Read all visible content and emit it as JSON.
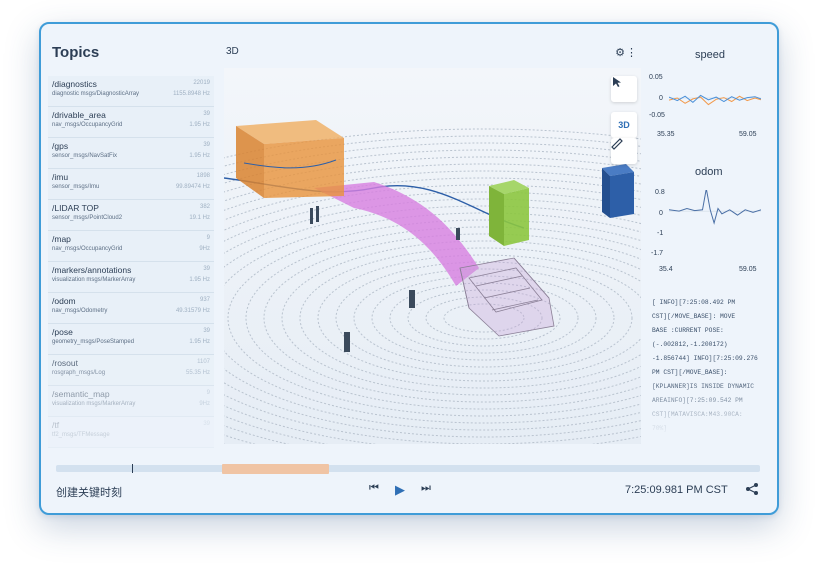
{
  "topics_panel": {
    "title": "Topics",
    "items": [
      {
        "name": "/diagnostics",
        "type": "diagnostic msgs/DiagnosticArray",
        "count": "22019",
        "rate": "1155.8948 Hz"
      },
      {
        "name": "/drivable_area",
        "type": "nav_msgs/OccupancyGrid",
        "count": "39",
        "rate": "1.95 Hz"
      },
      {
        "name": "/gps",
        "type": "sensor_msgs/NavSatFix",
        "count": "39",
        "rate": "1.95 Hz"
      },
      {
        "name": "/imu",
        "type": "sensor_msgs/Imu",
        "count": "1898",
        "rate": "99.89474 Hz"
      },
      {
        "name": "/LIDAR TOP",
        "type": "sensor_msgs/PointCloud2",
        "count": "382",
        "rate": "19.1 Hz"
      },
      {
        "name": "/map",
        "type": "nav_msgs/OccupancyGrid",
        "count": "9",
        "rate": "9Hz"
      },
      {
        "name": "/markers/annotations",
        "type": "visualization msgs/MarkerArray",
        "count": "39",
        "rate": "1.95 Hz"
      },
      {
        "name": "/odom",
        "type": "nav_msgs/Odometry",
        "count": "937",
        "rate": "49.31579 Hz"
      },
      {
        "name": "/pose",
        "type": "geometry_msgs/PoseStamped",
        "count": "39",
        "rate": "1.95 Hz"
      },
      {
        "name": "/rosout",
        "type": "rosgraph_msgs/Log",
        "count": "1107",
        "rate": "55.35 Hz"
      },
      {
        "name": "/semantic_map",
        "type": "visualization msgs/MarkerArray",
        "count": "9",
        "rate": "9Hz"
      },
      {
        "name": "/tf",
        "type": "tf2_msgs/TFMessage",
        "count": "39",
        "rate": ""
      }
    ]
  },
  "view3d": {
    "title": "3D",
    "settings_icon": "gear-icon",
    "more_icon": "kebab-icon",
    "tools": {
      "select_icon": "cursor-icon",
      "mode_label": "3D",
      "measure_icon": "ruler-icon"
    }
  },
  "charts": {
    "speed": {
      "title": "speed",
      "y_ticks": [
        "0.05",
        "0",
        "-0.05"
      ],
      "x_ticks": [
        "35.35",
        "59.05"
      ],
      "series_colors": [
        "#f2994a",
        "#4a90d9"
      ]
    },
    "odom": {
      "title": "odom",
      "y_ticks": [
        "0.8",
        "0",
        "-1",
        "-1.7"
      ],
      "x_ticks": [
        "35.4",
        "59.05"
      ],
      "series_colors": [
        "#4a6fa5"
      ]
    }
  },
  "chart_data": [
    {
      "type": "line",
      "title": "speed",
      "xlim": [
        35.35,
        59.05
      ],
      "ylim": [
        -0.05,
        0.05
      ],
      "series": [
        {
          "x": [
            35.35,
            37.5,
            39.5,
            41.5,
            43.5,
            45.5,
            47.5,
            49.5,
            51.5,
            53.5,
            55.5,
            57.5,
            59.05
          ],
          "y": [
            -0.005,
            0.0,
            -0.012,
            -0.002,
            0.002,
            -0.015,
            -0.003,
            0.001,
            -0.008,
            0.004,
            -0.006,
            0.0,
            -0.004
          ]
        },
        {
          "x": [
            35.35,
            37.5,
            39.5,
            41.5,
            43.5,
            45.5,
            47.5,
            49.5,
            51.5,
            53.5,
            55.5,
            57.5,
            59.05
          ],
          "y": [
            0.002,
            -0.006,
            0.004,
            -0.01,
            0.006,
            -0.004,
            0.002,
            -0.008,
            0.003,
            -0.005,
            0.001,
            0.003,
            -0.002
          ]
        }
      ]
    },
    {
      "type": "line",
      "title": "odom",
      "xlim": [
        35.4,
        59.05
      ],
      "ylim": [
        -1.7,
        0.8
      ],
      "series": [
        {
          "x": [
            35.4,
            38,
            40,
            42,
            44,
            45,
            46,
            47,
            48,
            49,
            51,
            53,
            55,
            57,
            59.05
          ],
          "y": [
            0.05,
            0.0,
            0.1,
            0.02,
            0.05,
            0.85,
            0.05,
            -0.45,
            0.1,
            -0.1,
            0.05,
            -0.15,
            0.05,
            -0.05,
            0.05
          ]
        }
      ]
    }
  ],
  "log": {
    "lines": [
      "[ INFO][7:25:08.492 PM",
      "CST][/MOVE_BASE]: MOVE",
      "BASE :CURRENT POSE:",
      "(-.002812,-1.200172)",
      "-1.856744] INFO][7:25:09.276",
      "PM CST][/MOVE_BASE]:",
      "[KPLANNER]IS INSIDE DYNAMIC",
      "AREAINFO][7:25:09.542 PM",
      "CST][MATAVISCA:M43.90CA:",
      "70%]"
    ]
  },
  "timeline": {
    "selection_color": "#f0c4a4"
  },
  "footer": {
    "keyframe_label": "创建关键时刻",
    "prev_icon": "skip-back-icon",
    "play_icon": "play-icon",
    "next_icon": "skip-forward-icon",
    "time": "7:25:09.981 PM CST",
    "share_icon": "share-icon"
  },
  "colors": {
    "accent": "#2f6fb5",
    "border": "#3f9cd8",
    "path": "#d77ee0",
    "box_orange": "#e8923a",
    "box_green": "#8cc63f",
    "box_blue": "#2d5fa8"
  }
}
